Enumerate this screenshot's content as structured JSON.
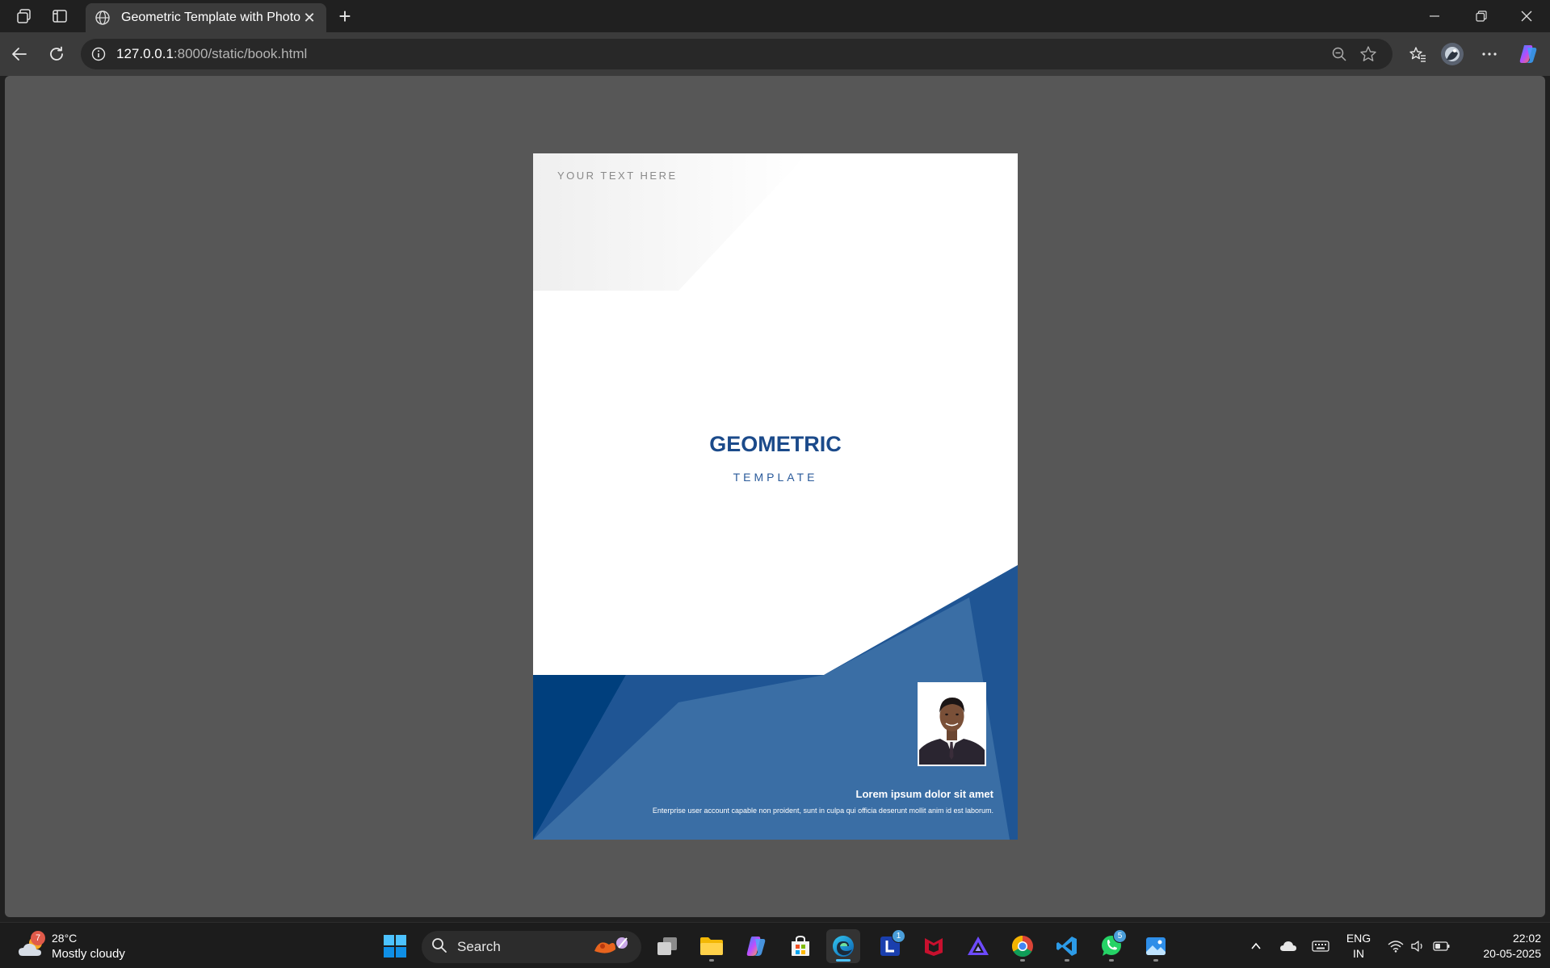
{
  "browser": {
    "tab_title": "Geometric Template with Photo",
    "url_host": "127.0.0.1",
    "url_path": ":8000/static/book.html"
  },
  "document": {
    "top_text": "YOUR TEXT HERE",
    "title": "GEOMETRIC",
    "subtitle": "TEMPLATE",
    "caption_title": "Lorem ipsum dolor sit amet",
    "caption_text": "Enterprise user account capable non proident, sunt in culpa qui officia deserunt mollit anim id est laborum.",
    "colors": {
      "title": "#1b4a8a",
      "blue_dark": "#003f7d",
      "blue_mid": "#1f5594",
      "blue_light": "#3a6ea5"
    }
  },
  "taskbar": {
    "weather": {
      "badge": "7",
      "temp": "28°C",
      "condition": "Mostly cloudy"
    },
    "search_label": "Search",
    "badges": {
      "l_app": "1",
      "whatsapp": "5"
    },
    "lang_line1": "ENG",
    "lang_line2": "IN",
    "time": "22:02",
    "date": "20-05-2025"
  }
}
